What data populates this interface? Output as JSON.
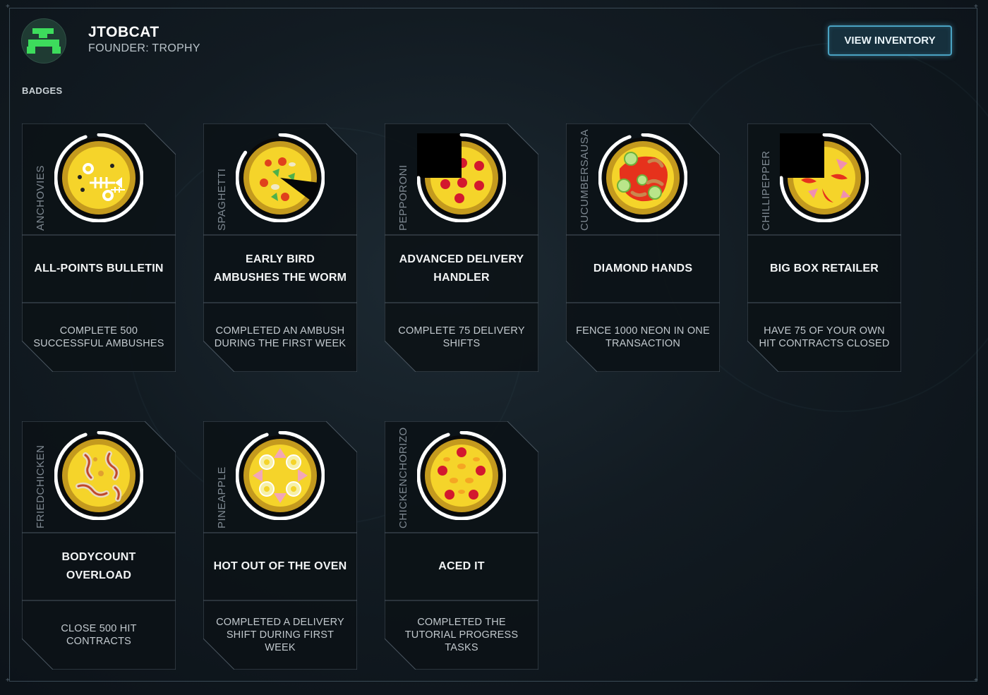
{
  "profile": {
    "username": "JTOBCAT",
    "subtitle": "FOUNDER: TROPHY"
  },
  "header": {
    "view_inventory_label": "VIEW INVENTORY"
  },
  "section": {
    "badges_label": "BADGES"
  },
  "badges": [
    {
      "category": "ANCHOVIES",
      "title": "ALL-POINTS BULLETIN",
      "description": "COMPLETE 500 SUCCESSFUL AMBUSHES",
      "icon": "anchovies-pizza-icon",
      "progress": 0.95
    },
    {
      "category": "SPAGHETTI",
      "title": "EARLY BIRD AMBUSHES THE WORM",
      "description": "COMPLETED AN AMBUSH DURING THE FIRST WEEK",
      "icon": "spaghetti-pizza-icon",
      "progress": 0.85
    },
    {
      "category": "PEPPORONI",
      "title": "ADVANCED DELIVERY HANDLER",
      "description": "COMPLETE 75 DELIVERY SHIFTS",
      "icon": "pepperoni-pizza-icon",
      "progress": 0.75
    },
    {
      "category": "CUCUMBERSAUSAGE",
      "title": "DIAMOND HANDS",
      "description": "FENCE 1000 NEON IN ONE TRANSACTION",
      "icon": "cucumber-sausage-pizza-icon",
      "progress": 0.95
    },
    {
      "category": "CHILLIPEPPER",
      "title": "BIG BOX RETAILER",
      "description": "HAVE 75 OF YOUR OWN HIT CONTRACTS CLOSED",
      "icon": "chilli-pepper-pizza-icon",
      "progress": 0.75
    },
    {
      "category": "FRIEDCHICKEN",
      "title": "BODYCOUNT OVERLOAD",
      "description": "CLOSE 500 HIT CONTRACTS",
      "icon": "fried-chicken-pizza-icon",
      "progress": 0.95
    },
    {
      "category": "PINEAPPLE",
      "title": "HOT OUT OF THE OVEN",
      "description": "COMPLETED A DELIVERY SHIFT DURING FIRST WEEK",
      "icon": "pineapple-pizza-icon",
      "progress": 0.95
    },
    {
      "category": "CHICKENCHORIZO",
      "title": "ACED IT",
      "description": "COMPLETED THE TUTORIAL PROGRESS TASKS",
      "icon": "chicken-chorizo-pizza-icon",
      "progress": 0.95
    }
  ],
  "colors": {
    "accent": "#4aa2c2",
    "avatar_green": "#3ddc5c",
    "card_border": "#4a5660",
    "card_fill": "#0c1217",
    "pizza_crust": "#c49a1e",
    "pizza_cheese": "#f5d42a",
    "pepperoni": "#d3182e"
  }
}
